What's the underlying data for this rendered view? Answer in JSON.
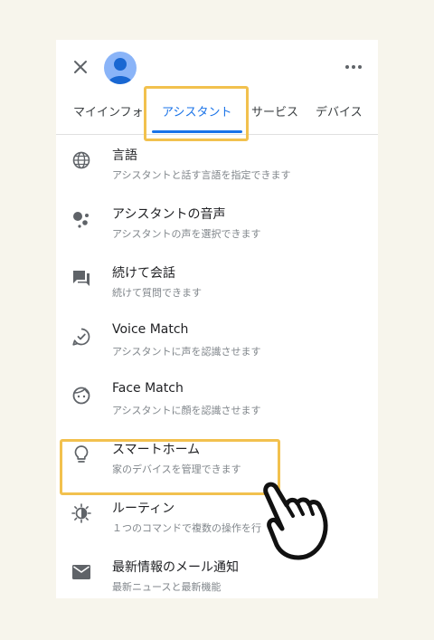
{
  "colors": {
    "accent": "#1a73e8",
    "highlight": "#f2c14e",
    "background": "#f7f5ec"
  },
  "header": {
    "close_icon": "close-icon",
    "avatar_icon": "account-avatar",
    "more_icon": "more-horiz-icon"
  },
  "tabs": [
    {
      "label": "マイインフォ",
      "active": false
    },
    {
      "label": "アシスタント",
      "active": true
    },
    {
      "label": "サービス",
      "active": false
    },
    {
      "label": "デバイス",
      "active": false
    }
  ],
  "settings": [
    {
      "icon": "globe-icon",
      "title": "言語",
      "subtitle": "アシスタントと話す言語を指定できます"
    },
    {
      "icon": "assistant-dots-icon",
      "title": "アシスタントの音声",
      "subtitle": "アシスタントの声を選択できます"
    },
    {
      "icon": "chat-icon",
      "title": "続けて会話",
      "subtitle": "続けて質問できます"
    },
    {
      "icon": "voice-match-icon",
      "title": "Voice Match",
      "subtitle": "アシスタントに声を認識させます"
    },
    {
      "icon": "face-icon",
      "title": "Face Match",
      "subtitle": "アシスタントに顔を認識させます"
    },
    {
      "icon": "lightbulb-icon",
      "title": "スマートホーム",
      "subtitle": "家のデバイスを管理できます"
    },
    {
      "icon": "routine-icon",
      "title": "ルーティン",
      "subtitle": "１つのコマンドで複数の操作を行"
    },
    {
      "icon": "mail-icon",
      "title": "最新情報のメール通知",
      "subtitle": "最新ニュースと最新機能"
    }
  ],
  "overlay": {
    "pointer_icon": "pointing-hand-icon"
  }
}
